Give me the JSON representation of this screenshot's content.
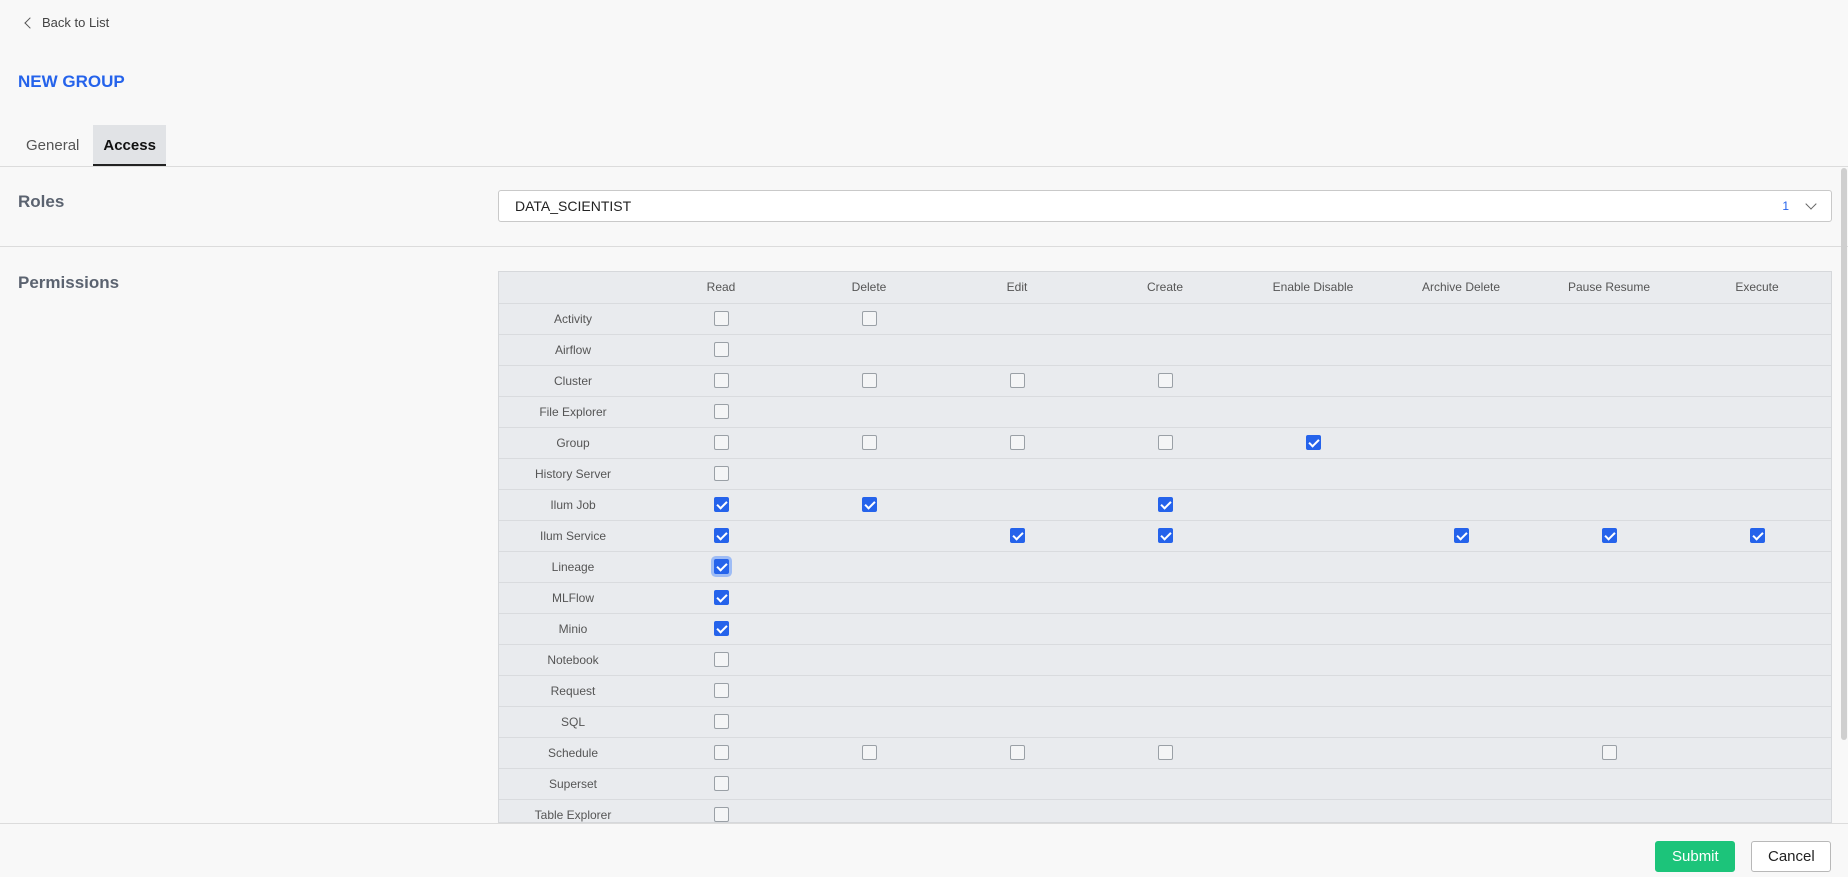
{
  "nav": {
    "back_label": "Back to List"
  },
  "page": {
    "title": "NEW GROUP"
  },
  "tabs": [
    {
      "label": "General",
      "active": false
    },
    {
      "label": "Access",
      "active": true
    }
  ],
  "roles": {
    "label": "Roles",
    "selected": "DATA_SCIENTIST",
    "count": "1"
  },
  "permissions": {
    "label": "Permissions",
    "columns": [
      "Read",
      "Delete",
      "Edit",
      "Create",
      "Enable Disable",
      "Archive Delete",
      "Pause Resume",
      "Execute"
    ],
    "rows": [
      {
        "name": "Activity",
        "cells": [
          0,
          0,
          null,
          null,
          null,
          null,
          null,
          null
        ]
      },
      {
        "name": "Airflow",
        "cells": [
          0,
          null,
          null,
          null,
          null,
          null,
          null,
          null
        ]
      },
      {
        "name": "Cluster",
        "cells": [
          0,
          0,
          0,
          0,
          null,
          null,
          null,
          null
        ]
      },
      {
        "name": "File Explorer",
        "cells": [
          0,
          null,
          null,
          null,
          null,
          null,
          null,
          null
        ]
      },
      {
        "name": "Group",
        "cells": [
          0,
          0,
          0,
          0,
          1,
          null,
          null,
          null
        ]
      },
      {
        "name": "History Server",
        "cells": [
          0,
          null,
          null,
          null,
          null,
          null,
          null,
          null
        ]
      },
      {
        "name": "Ilum Job",
        "cells": [
          1,
          1,
          null,
          1,
          null,
          null,
          null,
          null
        ]
      },
      {
        "name": "Ilum Service",
        "cells": [
          1,
          null,
          1,
          1,
          null,
          1,
          1,
          1
        ]
      },
      {
        "name": "Lineage",
        "cells": [
          1,
          null,
          null,
          null,
          null,
          null,
          null,
          null
        ],
        "focus": 0
      },
      {
        "name": "MLFlow",
        "cells": [
          1,
          null,
          null,
          null,
          null,
          null,
          null,
          null
        ]
      },
      {
        "name": "Minio",
        "cells": [
          1,
          null,
          null,
          null,
          null,
          null,
          null,
          null
        ]
      },
      {
        "name": "Notebook",
        "cells": [
          0,
          null,
          null,
          null,
          null,
          null,
          null,
          null
        ]
      },
      {
        "name": "Request",
        "cells": [
          0,
          null,
          null,
          null,
          null,
          null,
          null,
          null
        ]
      },
      {
        "name": "SQL",
        "cells": [
          0,
          null,
          null,
          null,
          null,
          null,
          null,
          null
        ]
      },
      {
        "name": "Schedule",
        "cells": [
          0,
          0,
          0,
          0,
          null,
          null,
          0,
          null
        ]
      },
      {
        "name": "Superset",
        "cells": [
          0,
          null,
          null,
          null,
          null,
          null,
          null,
          null
        ]
      },
      {
        "name": "Table Explorer",
        "cells": [
          0,
          null,
          null,
          null,
          null,
          null,
          null,
          null
        ]
      }
    ]
  },
  "footer": {
    "submit_label": "Submit",
    "cancel_label": "Cancel"
  },
  "colors": {
    "accent": "#2563eb",
    "submit": "#1cc47a"
  }
}
